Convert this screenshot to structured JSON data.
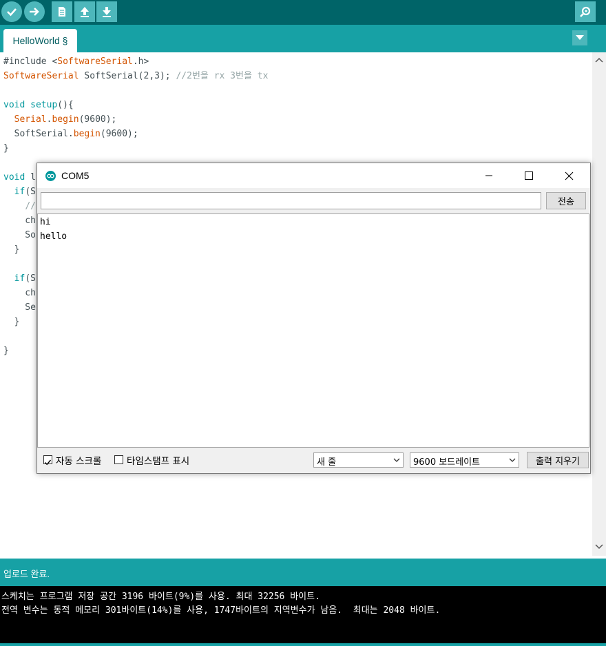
{
  "toolbar": {
    "buttons": [
      "verify-icon",
      "upload-icon",
      "new-icon",
      "open-icon",
      "save-icon"
    ],
    "serial_monitor_icon": "magnifier-icon"
  },
  "tabs": [
    {
      "label": "HelloWorld §"
    }
  ],
  "editor": {
    "lines": [
      "#include <SoftwareSerial.h>",
      "SoftwareSerial SoftSerial(2,3); //2번을 rx 3번을 tx",
      "",
      "void setup(){",
      "  Serial.begin(9600);",
      "  SoftSerial.begin(9600);",
      "}",
      "",
      "void l",
      "  if(S",
      "    //",
      "    ch",
      "    So",
      "  }",
      "",
      "  if(S",
      "    ch",
      "    Se",
      "  }",
      "",
      "}"
    ]
  },
  "status": {
    "text": "업로드 완료."
  },
  "console": {
    "lines": [
      "스케치는 프로그램 저장 공간 3196 바이트(9%)를 사용. 최대 32256 바이트.",
      "전역 변수는 동적 메모리 301바이트(14%)를 사용, 1747바이트의 지역변수가 남음.  최대는 2048 바이트."
    ]
  },
  "serial_monitor": {
    "title": "COM5",
    "input_value": "",
    "send_label": "전송",
    "output_lines": [
      "hi",
      "hello"
    ],
    "autoscroll_label": "자동 스크롤",
    "autoscroll_checked": true,
    "timestamp_label": "타임스탬프 표시",
    "timestamp_checked": false,
    "line_ending": "새 줄",
    "baud_rate": "9600 보드레이트",
    "clear_label": "출력 지우기"
  },
  "colors": {
    "toolbar_bg": "#006468",
    "tabbar_bg": "#17a1a5",
    "button_bg": "#4db7bb",
    "keyword": "#d35400",
    "type": "#00979c",
    "comment": "#95a5a6"
  }
}
